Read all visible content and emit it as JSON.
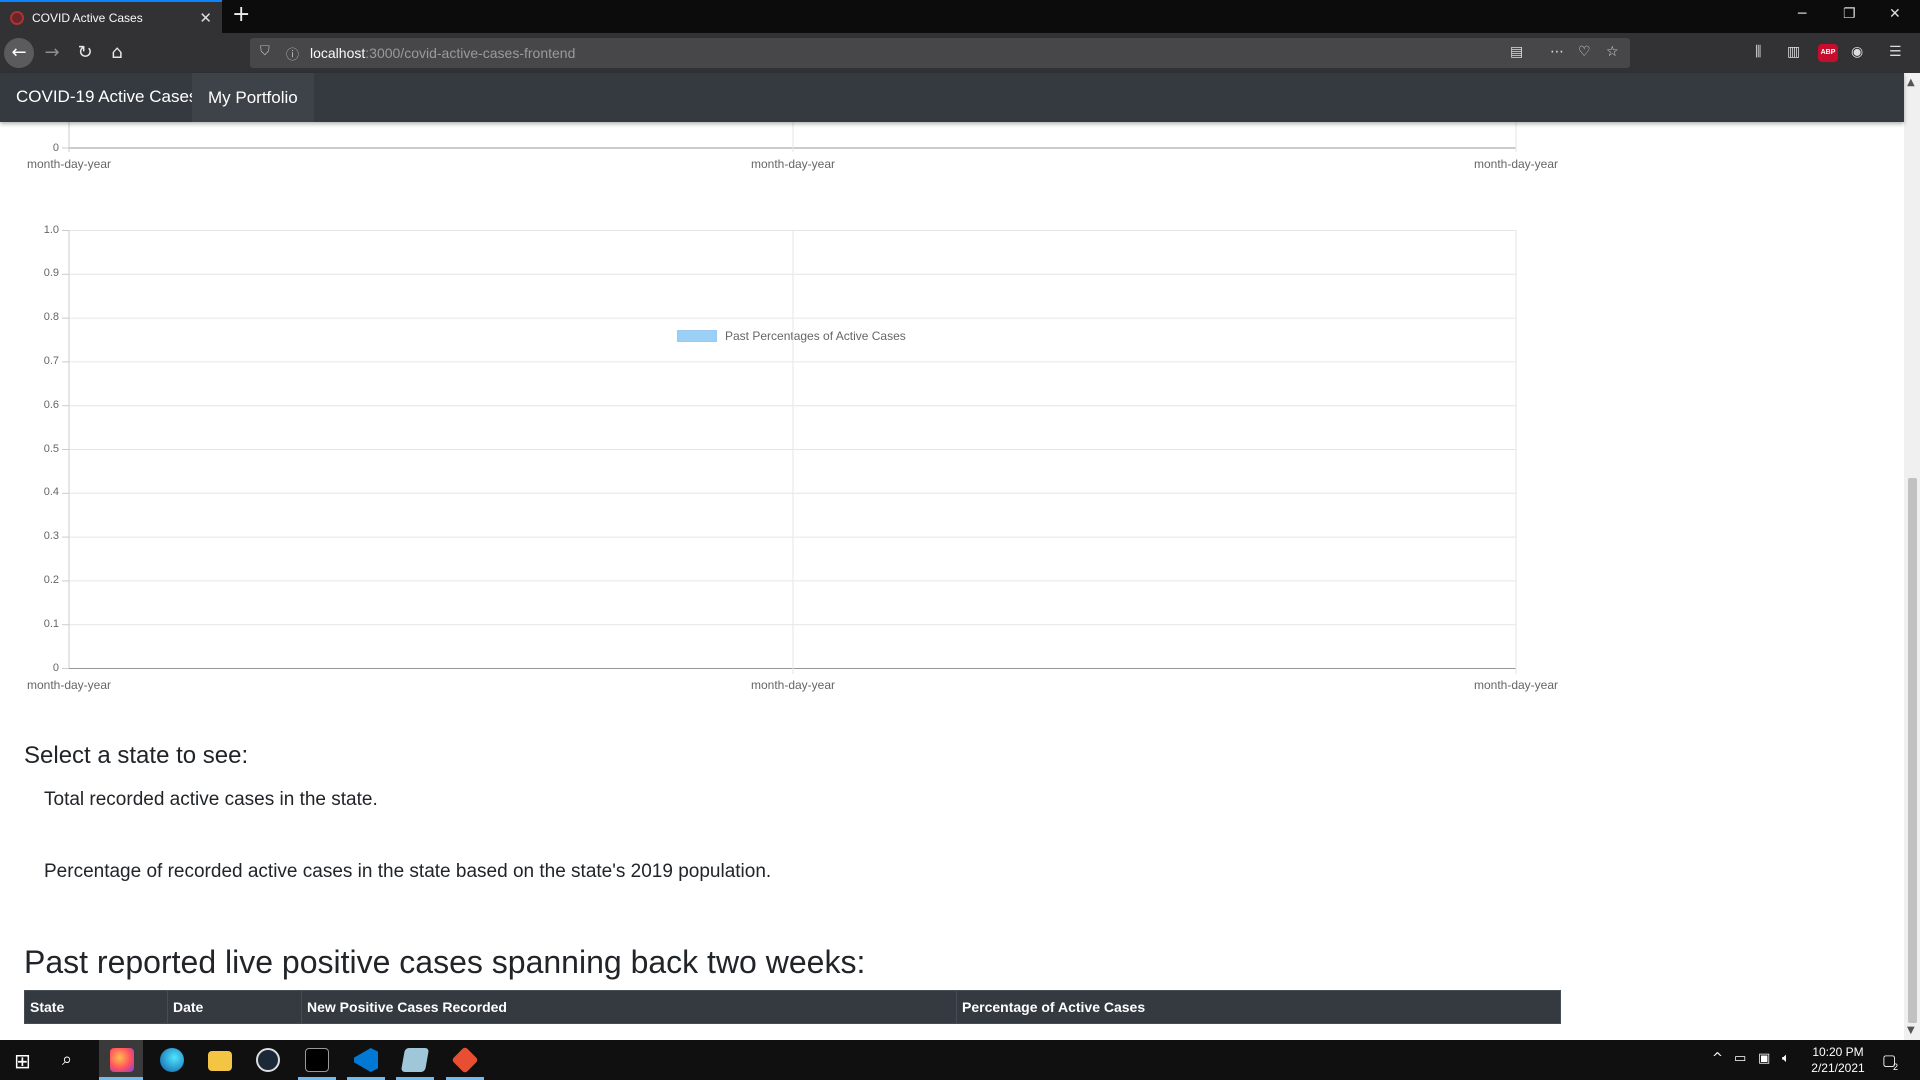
{
  "browser": {
    "tab_title": "COVID Active Cases",
    "tab_close": "✕",
    "new_tab": "+",
    "url_host": "localhost",
    "url_path": ":3000/covid-active-cases-frontend",
    "window_controls": [
      "─",
      "❐",
      "✕"
    ]
  },
  "site_nav": {
    "brand": "COVID-19 Active Cases",
    "portfolio": "My Portfolio"
  },
  "charts": {
    "top_partial": {
      "y_label": "0",
      "x_labels": [
        "month-day-year",
        "month-day-year",
        "month-day-year"
      ]
    },
    "percent_chart": {
      "legend": "Past Percentages of Active Cases",
      "y_labels": [
        "1.0",
        "0.9",
        "0.8",
        "0.7",
        "0.6",
        "0.5",
        "0.4",
        "0.3",
        "0.2",
        "0.1",
        "0"
      ],
      "x_labels": [
        "month-day-year",
        "month-day-year",
        "month-day-year"
      ]
    }
  },
  "chart_data": [
    {
      "type": "bar",
      "categories": [
        "month-day-year",
        "month-day-year",
        "month-day-year"
      ],
      "series": [],
      "title": "",
      "xlabel": "",
      "ylabel": "",
      "ylim": [
        0,
        null
      ],
      "grid": true
    },
    {
      "type": "bar",
      "categories": [
        "month-day-year",
        "month-day-year",
        "month-day-year"
      ],
      "series": [
        {
          "name": "Past Percentages of Active Cases",
          "values": []
        }
      ],
      "legend_position": "top",
      "title": "",
      "xlabel": "",
      "ylabel": "",
      "ylim": [
        0,
        1.0
      ],
      "grid": true,
      "colors": {
        "series": "#36a2eb"
      }
    }
  ],
  "select_section": {
    "heading": "Select a state to see:",
    "line1": "Total recorded active cases in the state.",
    "line2": "Percentage of recorded active cases in the state based on the state's 2019 population."
  },
  "past_section": {
    "heading": "Past reported live positive cases spanning back two weeks:",
    "columns": [
      "State",
      "Date",
      "New Positive Cases Recorded",
      "Percentage of Active Cases"
    ]
  },
  "taskbar": {
    "time": "10:20 PM",
    "date": "2/21/2021",
    "notification_count": "2"
  },
  "colors": {
    "nav_bg": "#343a40",
    "chrome_bg": "#323234",
    "accent": "#0a84ff",
    "legend_fill": "#36a2eb"
  }
}
